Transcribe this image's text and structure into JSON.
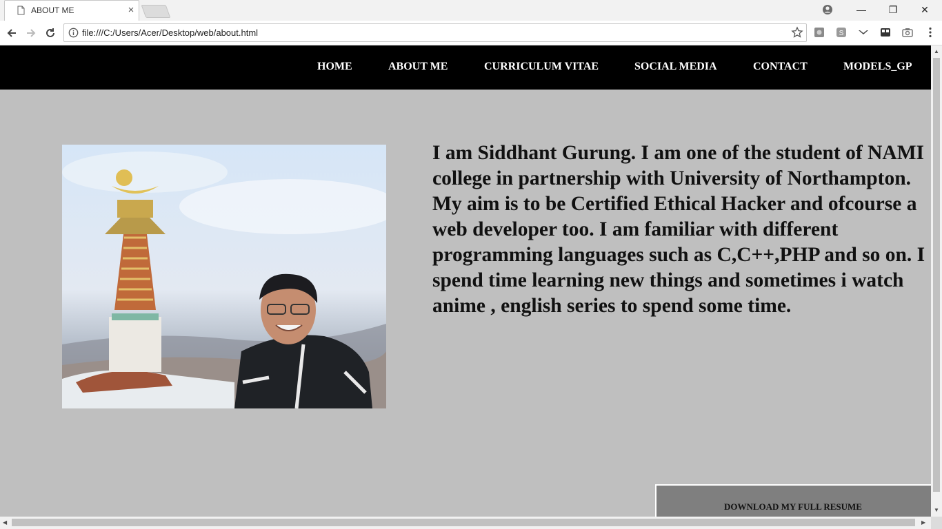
{
  "browser": {
    "tab_title": "ABOUT ME",
    "tab_close": "×",
    "url": "file:///C:/Users/Acer/Desktop/web/about.html",
    "window_controls": {
      "minimize": "—",
      "maximize": "❐",
      "close": "✕"
    }
  },
  "nav": {
    "items": [
      "HOME",
      "ABOUT ME",
      "CURRICULUM VITAE",
      "SOCIAL MEDIA",
      "CONTACT",
      "MODELS_GP"
    ]
  },
  "bio": "I am Siddhant Gurung. I am one of the student of NAMI college in partnership with University of Northampton. My aim is to be Certified Ethical Hacker and ofcourse a web developer too. I am familiar with different programming languages such as C,C++,PHP and so on. I spend time learning new things and sometimes i watch anime , english series to spend some time.",
  "download_label": "DOWNLOAD MY FULL RESUME",
  "colors": {
    "nav_bg": "#000000",
    "page_bg": "#bfbfbf",
    "button_bg": "#7f7f7f"
  }
}
